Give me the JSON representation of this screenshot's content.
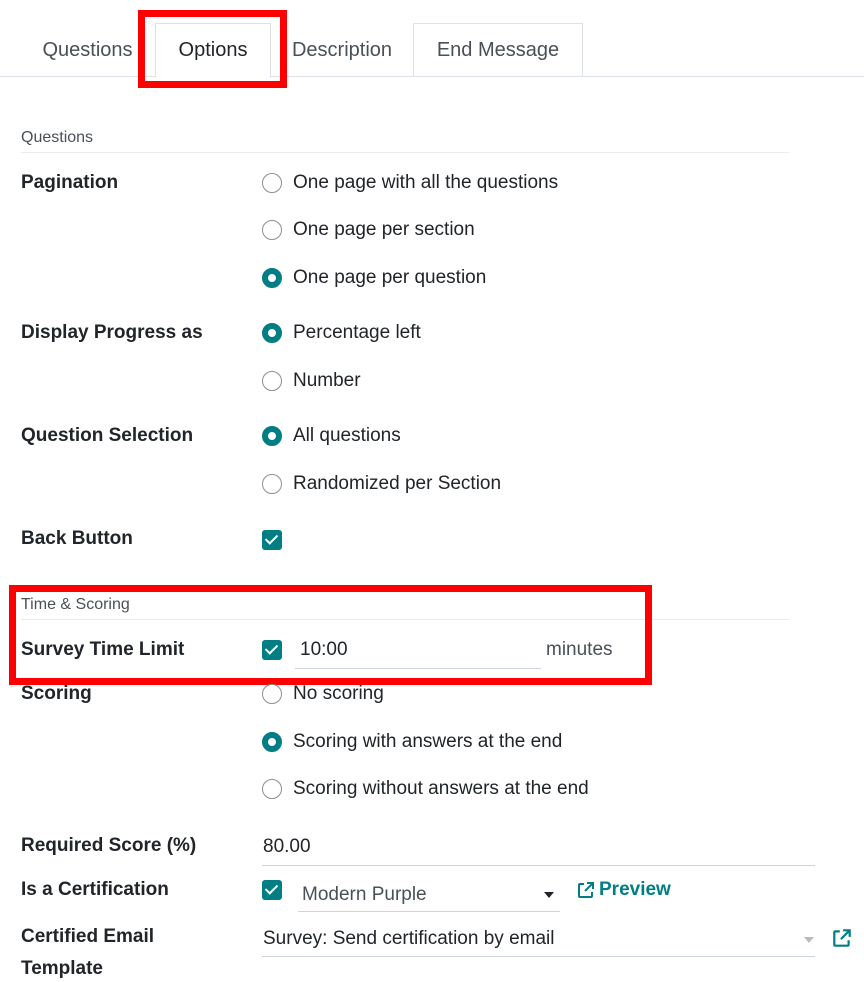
{
  "tabs": [
    {
      "label": "Questions"
    },
    {
      "label": "Options"
    },
    {
      "label": "Description"
    },
    {
      "label": "End Message"
    }
  ],
  "sections": {
    "questions": "Questions",
    "time_scoring": "Time & Scoring"
  },
  "pagination": {
    "label": "Pagination",
    "options": [
      "One page with all the questions",
      "One page per section",
      "One page per question"
    ],
    "selected": 2
  },
  "progress": {
    "label": "Display Progress as",
    "options": [
      "Percentage left",
      "Number"
    ],
    "selected": 0
  },
  "question_selection": {
    "label": "Question Selection",
    "options": [
      "All questions",
      "Randomized per Section"
    ],
    "selected": 0
  },
  "back_button": {
    "label": "Back Button",
    "checked": true
  },
  "time_limit": {
    "label": "Survey Time Limit",
    "checked": true,
    "value": "10:00",
    "unit": "minutes"
  },
  "scoring": {
    "label": "Scoring",
    "options": [
      "No scoring",
      "Scoring with answers at the end",
      "Scoring without answers at the end"
    ],
    "selected": 1
  },
  "required_score": {
    "label": "Required Score (%)",
    "value": "80.00"
  },
  "certification": {
    "label": "Is a Certification",
    "checked": true,
    "template": "Modern Purple",
    "preview_label": "Preview"
  },
  "certified_email": {
    "label_line1": "Certified Email",
    "label_line2": "Template",
    "value": "Survey: Send certification by email"
  },
  "colors": {
    "accent": "#017e84",
    "highlight": "#ff0000"
  }
}
